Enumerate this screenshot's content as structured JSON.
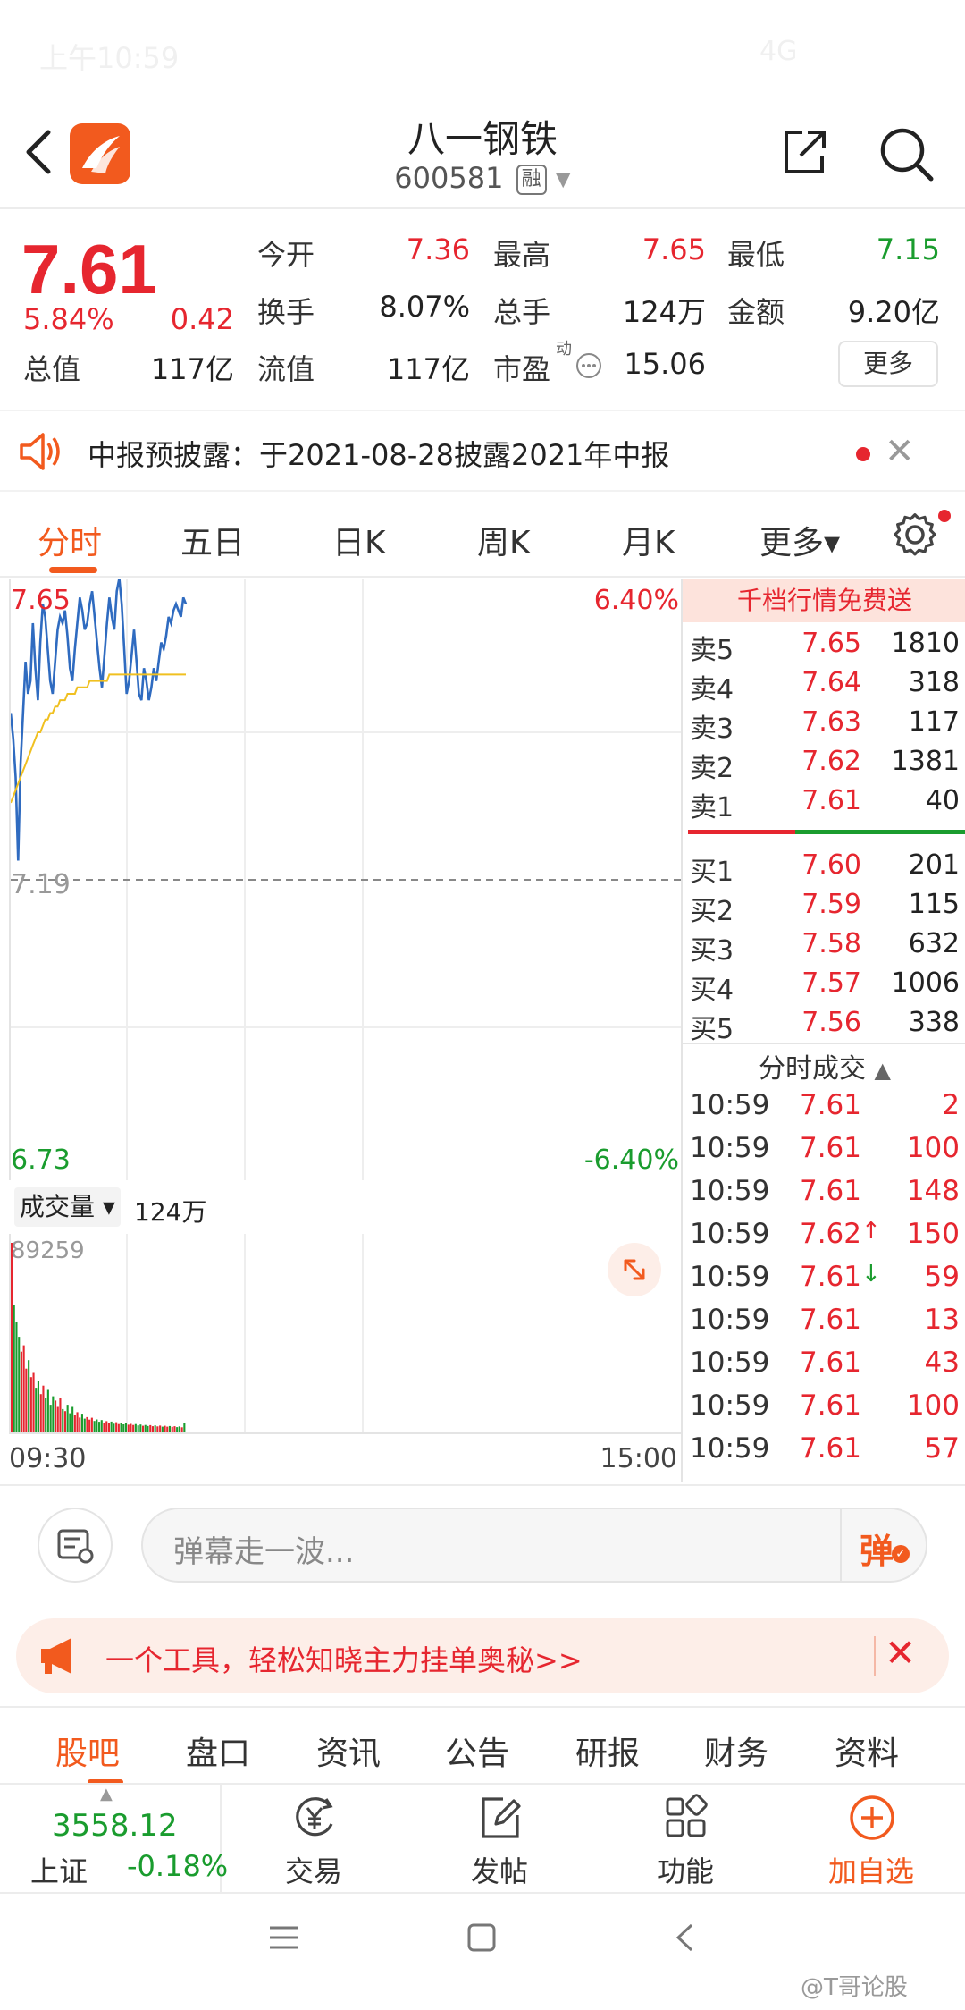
{
  "status_bar": {
    "time": "上午10:59",
    "right": "4G"
  },
  "header": {
    "stock_name": "八一钢铁",
    "stock_code": "600581",
    "margin_badge": "融"
  },
  "quote": {
    "price": "7.61",
    "change_pct": "5.84%",
    "change_amt": "0.42",
    "fields": {
      "open_label": "今开",
      "open": "7.36",
      "high_label": "最高",
      "high": "7.65",
      "low_label": "最低",
      "low": "7.15",
      "turnover_label": "换手",
      "turnover": "8.07%",
      "volume_label": "总手",
      "volume": "124万",
      "amount_label": "金额",
      "amount": "9.20亿",
      "mktcap_label": "总值",
      "mktcap": "117亿",
      "float_label": "流值",
      "float": "117亿",
      "pe_label": "市盈",
      "pe_sup": "动",
      "pe": "15.06"
    },
    "more_label": "更多"
  },
  "notice": {
    "text": "中报预披露：于2021-08-28披露2021年中报"
  },
  "tabs": [
    "分时",
    "五日",
    "日K",
    "周K",
    "月K",
    "更多▾"
  ],
  "chart": {
    "y_top": "7.65",
    "y_mid": "7.19",
    "y_bottom": "6.73",
    "pct_top": "6.40%",
    "pct_bottom": "-6.40%",
    "volume_select": "成交量 ▾",
    "volume_total": "124万",
    "volume_max": "89259",
    "time_start": "09:30",
    "time_end": "15:00"
  },
  "chart_data": {
    "type": "line",
    "title": "",
    "series": [
      {
        "values": [
          7.45,
          7.41,
          7.35,
          7.22,
          7.37,
          7.45,
          7.53,
          7.48,
          7.5,
          7.59,
          7.52,
          7.47,
          7.56,
          7.62,
          7.6,
          7.55,
          7.5,
          7.48,
          7.53,
          7.58,
          7.6,
          7.59,
          7.61,
          7.57,
          7.52,
          7.5,
          7.55,
          7.59,
          7.63,
          7.61,
          7.58,
          7.59,
          7.62,
          7.64,
          7.6,
          7.56,
          7.52,
          7.49,
          7.54,
          7.59,
          7.63,
          7.6,
          7.58,
          7.64,
          7.66,
          7.62,
          7.55,
          7.48,
          7.5,
          7.54,
          7.58,
          7.53,
          7.48,
          7.47,
          7.52,
          7.5,
          7.47,
          7.49,
          7.52,
          7.5,
          7.53,
          7.56,
          7.55,
          7.57,
          7.6,
          7.59,
          7.61,
          7.62,
          7.61,
          7.6,
          7.63,
          7.62
        ]
      },
      {
        "values": [
          7.31,
          7.32,
          7.33,
          7.34,
          7.35,
          7.36,
          7.37,
          7.38,
          7.39,
          7.4,
          7.41,
          7.42,
          7.42,
          7.43,
          7.44,
          7.44,
          7.45,
          7.45,
          7.46,
          7.46,
          7.47,
          7.47,
          7.47,
          7.48,
          7.48,
          7.48,
          7.48,
          7.49,
          7.49,
          7.49,
          7.49,
          7.49,
          7.5,
          7.5,
          7.5,
          7.5,
          7.5,
          7.5,
          7.5,
          7.5,
          7.51,
          7.51,
          7.51,
          7.51,
          7.51,
          7.51,
          7.51,
          7.51,
          7.51,
          7.51,
          7.51,
          7.51,
          7.51,
          7.51,
          7.51,
          7.51,
          7.51,
          7.51,
          7.51,
          7.51,
          7.51,
          7.51,
          7.51,
          7.51,
          7.51,
          7.51,
          7.51,
          7.51,
          7.51,
          7.51,
          7.51,
          7.51
        ]
      }
    ],
    "ylim": [
      6.73,
      7.65
    ],
    "volume": [
      89259,
      60000,
      52000,
      45000,
      38000,
      41000,
      30000,
      34000,
      26000,
      28000,
      21000,
      24000,
      18000,
      22000,
      16000,
      20000,
      13000,
      17000,
      15000,
      12000,
      16000,
      11000,
      10000,
      13000,
      9000,
      12000,
      8000,
      9500,
      7000,
      8800,
      6500,
      7200,
      6000,
      6900,
      5400,
      6100,
      5000,
      5800,
      4600,
      5300,
      4400,
      5100,
      4100,
      4800,
      3900,
      4500,
      3800,
      4300,
      3600,
      4000,
      3500,
      3900,
      3300,
      3700,
      3100,
      3500,
      3000,
      3400,
      2900,
      3300,
      2800,
      3200,
      2700,
      3100,
      2700,
      3000,
      2600,
      2900,
      2500,
      2800,
      2400,
      4500
    ]
  },
  "order_book": {
    "banner": "千档行情免费送",
    "asks": [
      {
        "label": "卖5",
        "price": "7.65",
        "vol": "1810"
      },
      {
        "label": "卖4",
        "price": "7.64",
        "vol": "318"
      },
      {
        "label": "卖3",
        "price": "7.63",
        "vol": "117"
      },
      {
        "label": "卖2",
        "price": "7.62",
        "vol": "1381"
      },
      {
        "label": "卖1",
        "price": "7.61",
        "vol": "40"
      }
    ],
    "bids": [
      {
        "label": "买1",
        "price": "7.60",
        "vol": "201"
      },
      {
        "label": "买2",
        "price": "7.59",
        "vol": "115"
      },
      {
        "label": "买3",
        "price": "7.58",
        "vol": "632"
      },
      {
        "label": "买4",
        "price": "7.57",
        "vol": "1006"
      },
      {
        "label": "买5",
        "price": "7.56",
        "vol": "338"
      }
    ],
    "trades_header": "分时成交"
  },
  "trades": [
    {
      "time": "10:59",
      "price": "7.61",
      "arrow": "",
      "vol": "2"
    },
    {
      "time": "10:59",
      "price": "7.61",
      "arrow": "",
      "vol": "100"
    },
    {
      "time": "10:59",
      "price": "7.61",
      "arrow": "",
      "vol": "148"
    },
    {
      "time": "10:59",
      "price": "7.62",
      "arrow": "↑",
      "vol": "150"
    },
    {
      "time": "10:59",
      "price": "7.61",
      "arrow": "↓",
      "vol": "59"
    },
    {
      "time": "10:59",
      "price": "7.61",
      "arrow": "",
      "vol": "13"
    },
    {
      "time": "10:59",
      "price": "7.61",
      "arrow": "",
      "vol": "43"
    },
    {
      "time": "10:59",
      "price": "7.61",
      "arrow": "",
      "vol": "100"
    },
    {
      "time": "10:59",
      "price": "7.61",
      "arrow": "",
      "vol": "57"
    }
  ],
  "comment": {
    "placeholder": "弹幕走一波...",
    "button": "弹"
  },
  "promo": {
    "text": "一个工具，轻松知晓主力挂单奥秘>>"
  },
  "bottom_tabs": [
    "股吧",
    "盘口",
    "资讯",
    "公告",
    "研报",
    "财务",
    "资料"
  ],
  "index": {
    "value": "3558.12",
    "name": "上证",
    "change": "-0.18%"
  },
  "actions": [
    {
      "label": "交易",
      "icon": "yuan-trade-icon"
    },
    {
      "label": "发帖",
      "icon": "edit-icon"
    },
    {
      "label": "功能",
      "icon": "grid-icon"
    },
    {
      "label": "加自选",
      "icon": "add-circle-icon"
    }
  ],
  "watermark": "@T哥论股",
  "colors": {
    "accent": "#f25a1e",
    "up": "#e6262f",
    "down": "#1a9c2e",
    "price_line": "#2f6bc0",
    "avg_line": "#f0c020"
  }
}
